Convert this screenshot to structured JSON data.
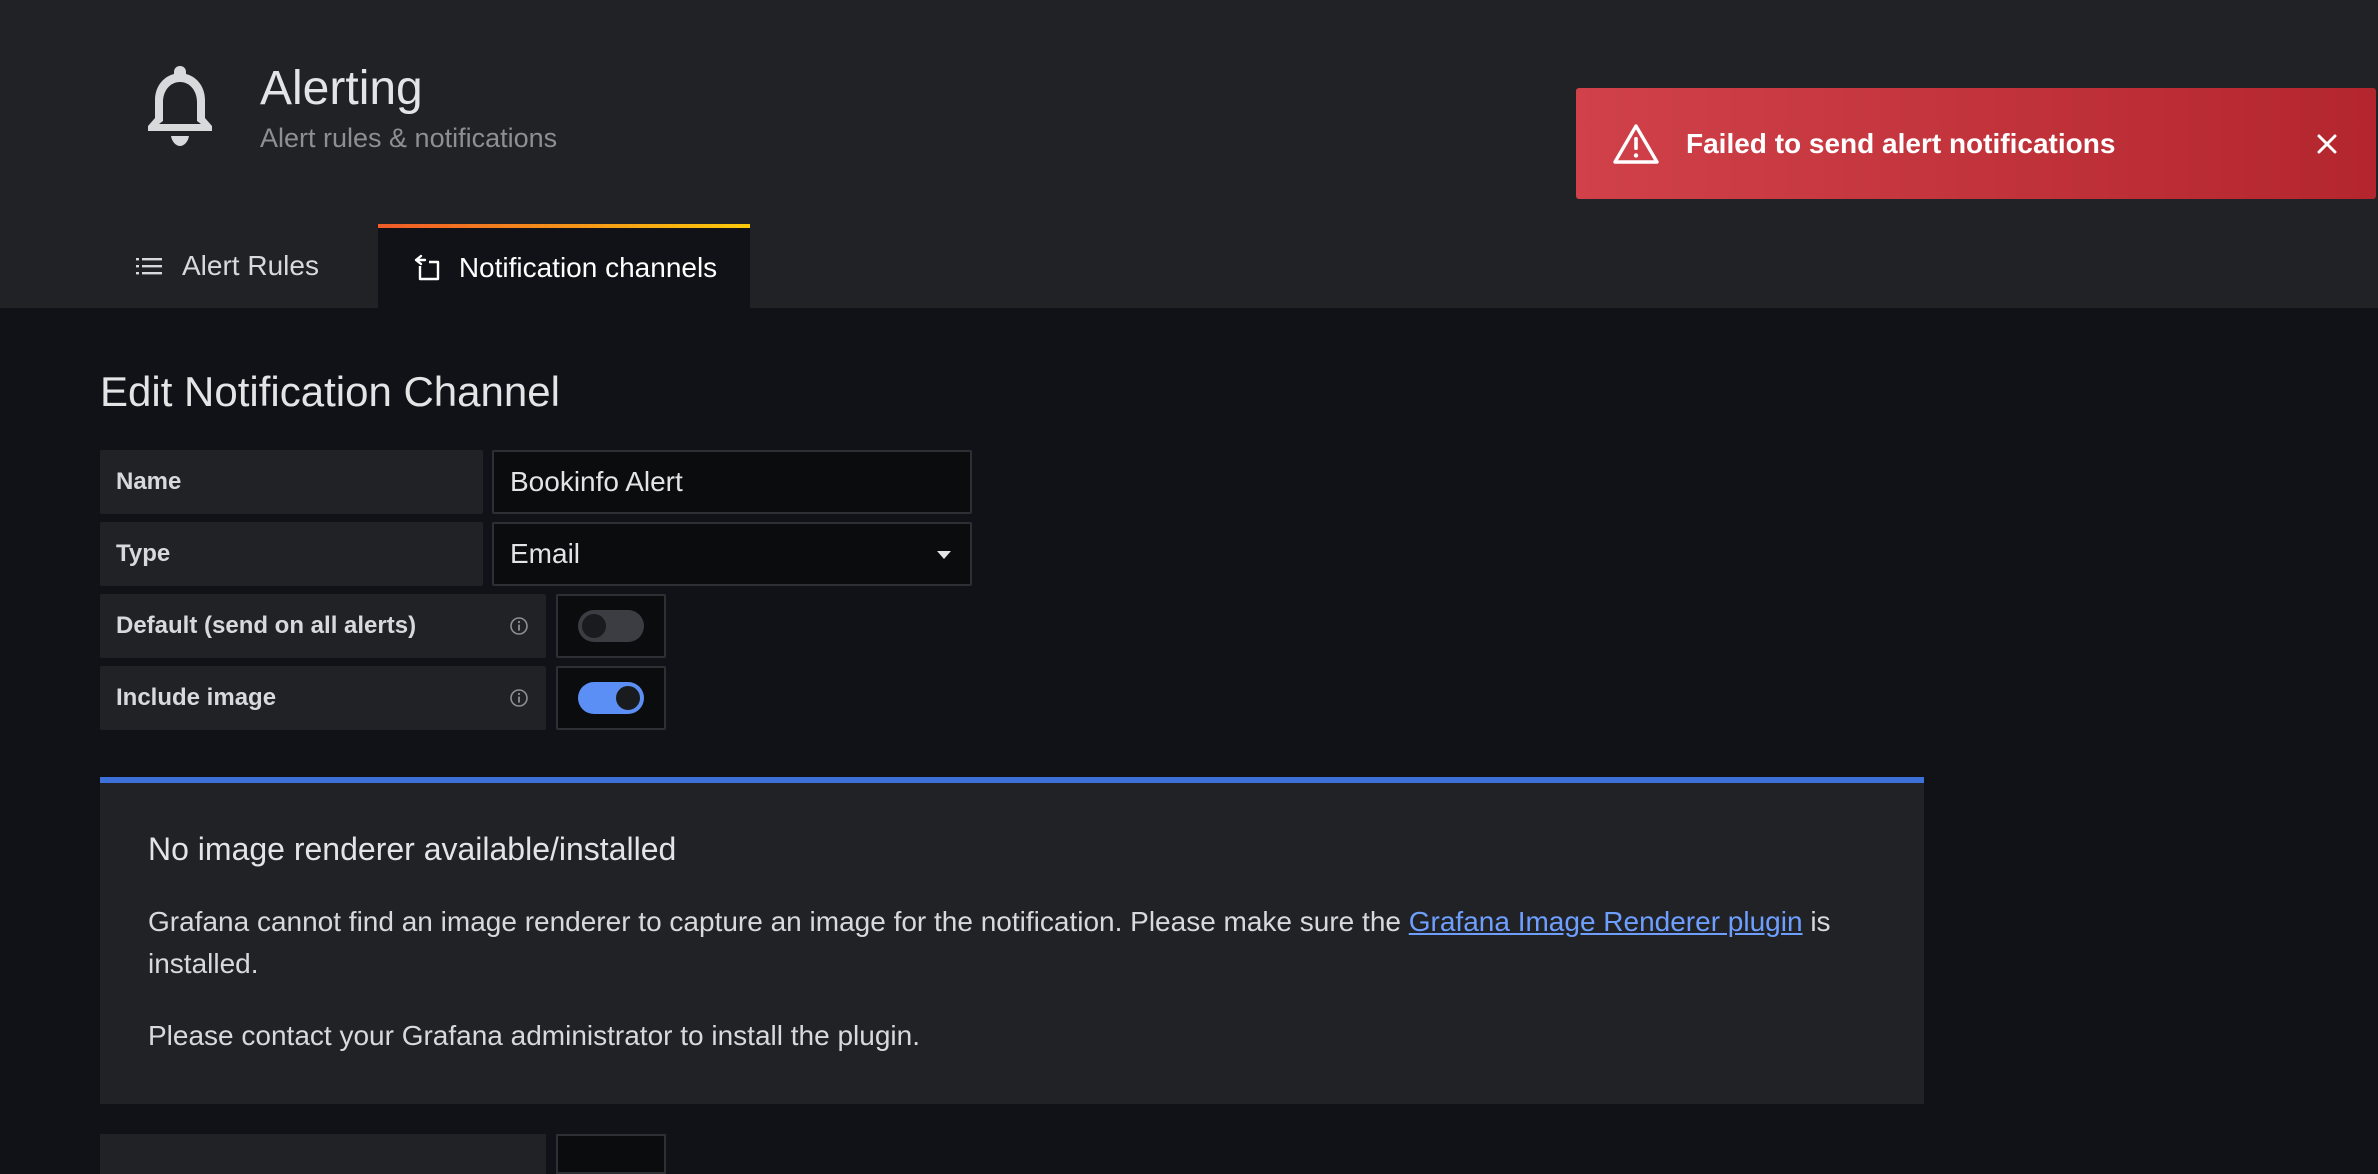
{
  "header": {
    "title": "Alerting",
    "subtitle": "Alert rules & notifications",
    "icon": "bell-icon"
  },
  "tabs": [
    {
      "label": "Alert Rules",
      "icon": "list-icon",
      "active": false
    },
    {
      "label": "Notification channels",
      "icon": "comment-alt-share-icon",
      "active": true
    }
  ],
  "toast": {
    "message": "Failed to send alert notifications",
    "icon": "exclamation-triangle-icon",
    "color": "#c4333b"
  },
  "form": {
    "title": "Edit Notification Channel",
    "name_label": "Name",
    "name_value": "Bookinfo Alert",
    "type_label": "Type",
    "type_value": "Email",
    "default_label": "Default (send on all alerts)",
    "default_on": false,
    "include_image_label": "Include image",
    "include_image_on": true
  },
  "info_alert": {
    "title": "No image renderer available/installed",
    "body_before": "Grafana cannot find an image renderer to capture an image for the notification. Please make sure the ",
    "link_text": "Grafana Image Renderer plugin",
    "body_after": " is installed.",
    "body2": "Please contact your Grafana administrator to install the plugin."
  },
  "colors": {
    "accent_blue": "#3d71d9",
    "switch_on": "#5b8ff5",
    "link": "#6e9fff"
  }
}
